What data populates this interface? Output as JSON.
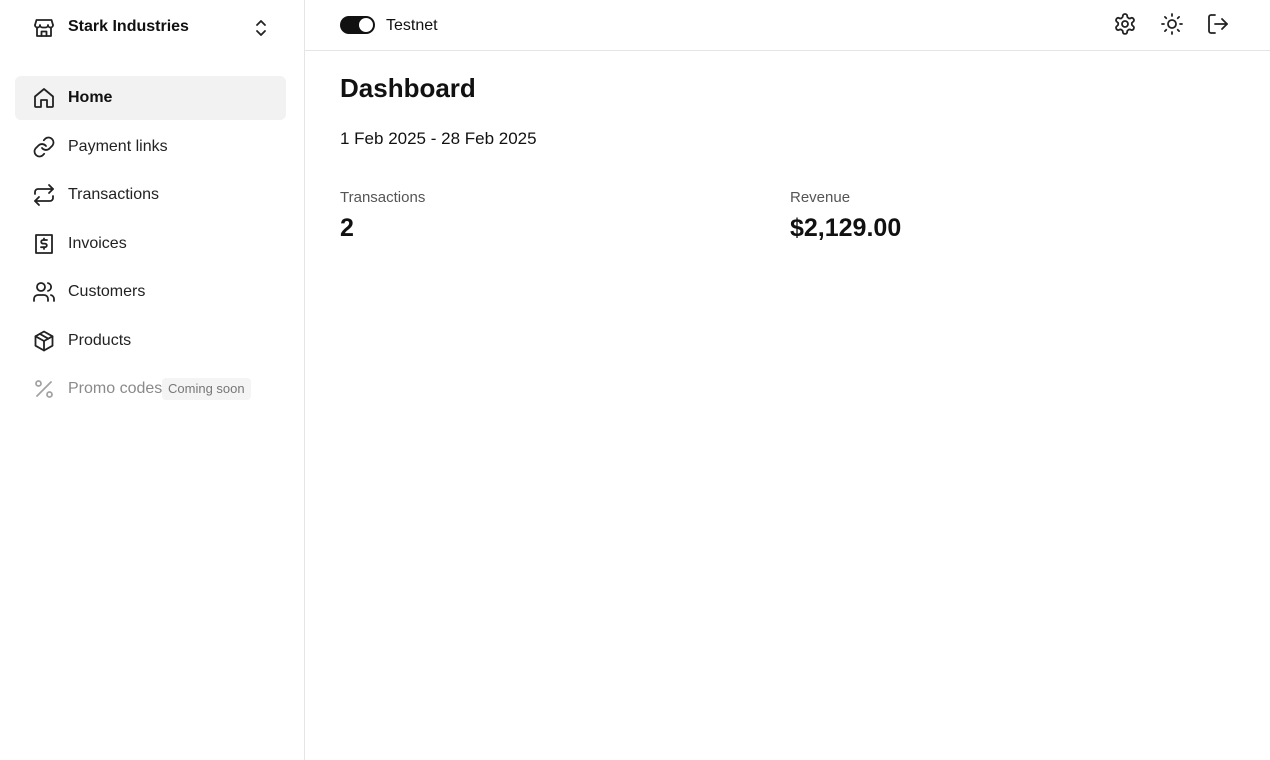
{
  "org": {
    "name": "Stark Industries",
    "icon": "store-icon"
  },
  "nav": {
    "items": [
      {
        "label": "Home",
        "icon": "home-icon",
        "active": true
      },
      {
        "label": "Payment links",
        "icon": "link-icon"
      },
      {
        "label": "Transactions",
        "icon": "repeat-icon"
      },
      {
        "label": "Invoices",
        "icon": "receipt-icon"
      },
      {
        "label": "Customers",
        "icon": "users-icon"
      },
      {
        "label": "Products",
        "icon": "package-icon"
      },
      {
        "label": "Promo codes",
        "icon": "percent-icon",
        "disabled": true,
        "badge": "Coming soon"
      }
    ]
  },
  "topbar": {
    "toggle_label": "Testnet",
    "toggle_on": true,
    "icons": [
      "settings-icon",
      "sun-icon",
      "logout-icon"
    ]
  },
  "main": {
    "title": "Dashboard",
    "date_range": "1 Feb 2025 - 28 Feb 2025",
    "stats": [
      {
        "label": "Transactions",
        "value": "2"
      },
      {
        "label": "Revenue",
        "value": "$2,129.00"
      }
    ]
  },
  "colors": {
    "active_bg": "#f2f2f2",
    "text": "#111111",
    "toggle_on": "#111111"
  }
}
